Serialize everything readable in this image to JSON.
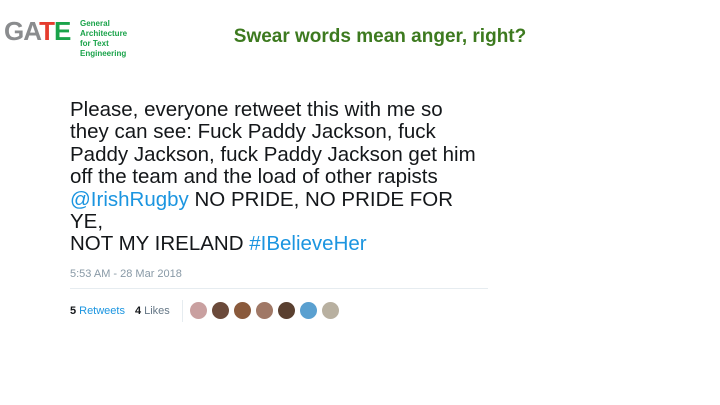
{
  "logo": {
    "ga": "GA",
    "t": "T",
    "e": "E",
    "subtitle_line1": "General Architecture",
    "subtitle_line2": "for Text Engineering"
  },
  "slide": {
    "title": "Swear words mean anger, right?"
  },
  "tweet": {
    "line1": "Please, everyone retweet this with me so",
    "line2": "they can see: Fuck Paddy Jackson, fuck",
    "line3": "Paddy Jackson, fuck Paddy Jackson get him",
    "line4": "off the team and the load of other rapists",
    "mention": "@IrishRugby",
    "line5_rest": " NO PRIDE, NO PRIDE FOR YE,",
    "line6_start": "NOT MY IRELAND ",
    "hashtag": "#IBelieveHer",
    "timestamp": "5:53 AM - 28 Mar 2018",
    "retweets_count": "5",
    "retweets_label": "Retweets",
    "likes_count": "4",
    "likes_label": "Likes",
    "avatar_colors": [
      "#c9a0a0",
      "#6b4a3a",
      "#8a5a3c",
      "#a07866",
      "#5a4030",
      "#5aa0d0",
      "#b8b0a0"
    ]
  },
  "colors": {
    "title_green": "#3d7a1f",
    "link_blue": "#1b95e0"
  }
}
